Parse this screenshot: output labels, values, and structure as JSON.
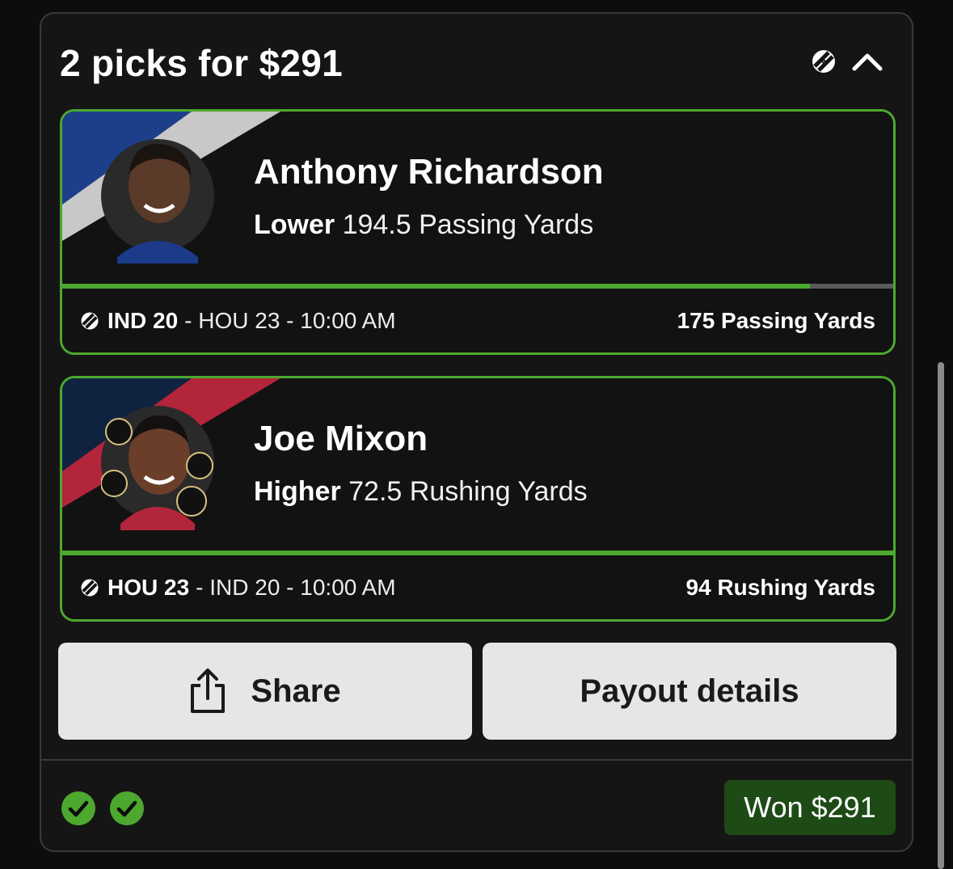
{
  "header": {
    "title": "2 picks for $291",
    "sport_icon": "football-icon",
    "collapse_icon": "chevron-up-icon"
  },
  "picks": [
    {
      "player": "Anthony Richardson",
      "direction": "Lower",
      "line": "194.5 Passing Yards",
      "progress": 0.9,
      "team": "IND 20",
      "game_rest": "- HOU 23 - 10:00 AM",
      "result": "175 Passing Yards",
      "stripe_colors": [
        "#1d3f8a",
        "#c8c8c8"
      ]
    },
    {
      "player": "Joe Mixon",
      "direction": "Higher",
      "line": "72.5 Rushing Yards",
      "progress": 1.0,
      "team": "HOU 23",
      "game_rest": "- IND 20 - 10:00 AM",
      "result": "94 Rushing Yards",
      "stripe_colors": [
        "#0f2340",
        "#b3253a"
      ]
    }
  ],
  "actions": {
    "share_label": "Share",
    "payout_label": "Payout details"
  },
  "footer": {
    "status_icons": [
      "check-circle-icon",
      "check-circle-icon"
    ],
    "won_label": "Won $291"
  },
  "colors": {
    "accent_green": "#4ca82f",
    "won_bg": "#1e4a16",
    "card_bg": "#121212"
  }
}
